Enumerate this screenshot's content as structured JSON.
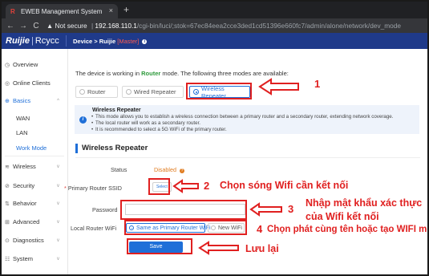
{
  "browser": {
    "tab_title": "EWEB Management System",
    "tab_close": "×",
    "new_tab": "+",
    "back": "←",
    "forward": "→",
    "reload": "C",
    "warning": "▲ Not secure",
    "url_host": "192.168.110.1",
    "url_path": "/cgi-bin/luci/;stok=67ec84eea2cce3ded1cd51396e660fc7/admin/alone/network/dev_mode"
  },
  "header": {
    "brand": "Ruijie",
    "brand_sep": "|",
    "brand2": "Rcycc",
    "device_mode": "Device > Ruijie",
    "master": "[Master]"
  },
  "sidebar": {
    "items": [
      {
        "icon": "◷",
        "label": "Overview"
      },
      {
        "icon": "◎",
        "label": "Online Clients"
      },
      {
        "icon": "⊕",
        "label": "Basics"
      },
      {
        "icon": "≋",
        "label": "Wireless"
      },
      {
        "icon": "⊘",
        "label": "Security"
      },
      {
        "icon": "⇅",
        "label": "Behavior"
      },
      {
        "icon": "⊞",
        "label": "Advanced"
      },
      {
        "icon": "⊙",
        "label": "Diagnostics"
      },
      {
        "icon": "☷",
        "label": "System"
      }
    ],
    "sub": [
      "WAN",
      "LAN",
      "Work Mode"
    ],
    "chevron_up": "^",
    "chevron_down": "v"
  },
  "content": {
    "mode_intro_pre": "The device is working in ",
    "mode_current": "Router",
    "mode_intro_post": " mode. The following three modes are available:",
    "modes": [
      "Router",
      "Wired Repeater",
      "Wireless Repeater"
    ],
    "info_title": "Wireless Repeater",
    "info_bullets": [
      "This mode allows you to establish a wireless connection between a primary router and a secondary router, extending network coverage.",
      "The local router will work as a secondary router.",
      "It is recommended to select a 5G WiFi of the primary router."
    ],
    "section_title": "Wireless Repeater",
    "status_label": "Status",
    "status_value": "Disabled",
    "ssid_label": "Primary Router SSID",
    "ssid_required": "*",
    "select_btn": "Select",
    "password_label": "Password",
    "local_wifi_label": "Local Router WiFi",
    "wifi_options": [
      "Same as Primary Router WiFi",
      "New WiFi"
    ],
    "save_btn": "Save"
  },
  "annotations": {
    "n1": "1",
    "n2": "2",
    "t2": "Chọn sóng Wifi cần kết nối",
    "n3": "3",
    "t3a": "Nhập mật khẩu xác thực",
    "t3b": "của Wifi kết nối",
    "n4": "4",
    "t4": "Chọn phát cùng tên hoặc tạo WIFI mới",
    "t5": "Lưu lại"
  },
  "colors": {
    "annotation_red": "#e02020",
    "primary_blue": "#1f6fd8",
    "header_navy": "#1f3a8a"
  }
}
